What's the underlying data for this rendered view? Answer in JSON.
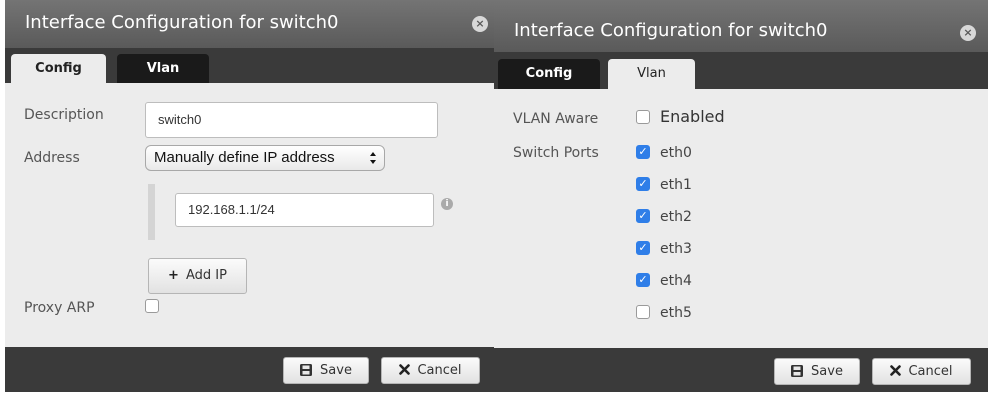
{
  "left_dialog": {
    "title": "Interface Configuration for switch0",
    "close_glyph": "×",
    "tabs": [
      {
        "label": "Config",
        "active": true
      },
      {
        "label": "Vlan",
        "active": false
      }
    ],
    "description": {
      "label": "Description",
      "value": "switch0"
    },
    "address": {
      "label": "Address",
      "selected": "Manually define IP address",
      "arrow": "▲▼"
    },
    "ip_address": {
      "value": "192.168.1.1/24",
      "info_glyph": "i"
    },
    "add_ip_button": {
      "icon": "+",
      "label": "Add IP"
    },
    "proxy_arp": {
      "label": "Proxy ARP",
      "checked": false
    },
    "footer": {
      "save_label": "Save",
      "save_icon": "save-icon",
      "cancel_label": "Cancel",
      "cancel_icon": "close-x-icon"
    }
  },
  "right_dialog": {
    "title": "Interface Configuration for switch0",
    "close_glyph": "×",
    "tabs": [
      {
        "label": "Config",
        "active": false
      },
      {
        "label": "Vlan",
        "active": true
      }
    ],
    "vlan_aware": {
      "label": "VLAN Aware",
      "option_label": "Enabled",
      "checked": false
    },
    "switch_ports": {
      "label": "Switch Ports",
      "ports": [
        {
          "name": "eth0",
          "checked": true
        },
        {
          "name": "eth1",
          "checked": true
        },
        {
          "name": "eth2",
          "checked": true
        },
        {
          "name": "eth3",
          "checked": true
        },
        {
          "name": "eth4",
          "checked": true
        },
        {
          "name": "eth5",
          "checked": false
        }
      ]
    },
    "footer": {
      "save_label": "Save",
      "save_icon": "save-icon",
      "cancel_label": "Cancel",
      "cancel_icon": "close-x-icon"
    }
  },
  "colors": {
    "titlebar": "#666666",
    "tabstrip": "#3a3a3a",
    "body": "#ececec",
    "checkbox_checked": "#2f7ee8"
  }
}
